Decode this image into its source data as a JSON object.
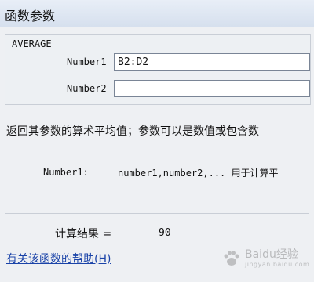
{
  "window": {
    "title": "函数参数"
  },
  "function": {
    "name": "AVERAGE",
    "args": [
      {
        "label": "Number1",
        "value": "B2:D2"
      },
      {
        "label": "Number2",
        "value": ""
      }
    ]
  },
  "description": "返回其参数的算术平均值；参数可以是数值或包含数",
  "arg_help": {
    "name": "Number1:",
    "text": "number1,number2,... 用于计算平"
  },
  "result": {
    "label": "计算结果 =",
    "value": "90"
  },
  "help_link": "有关该函数的帮助(H)",
  "watermark": {
    "text": "Baidu经验",
    "sub": "jingyan.baidu.com",
    "icon": "paw-icon"
  }
}
